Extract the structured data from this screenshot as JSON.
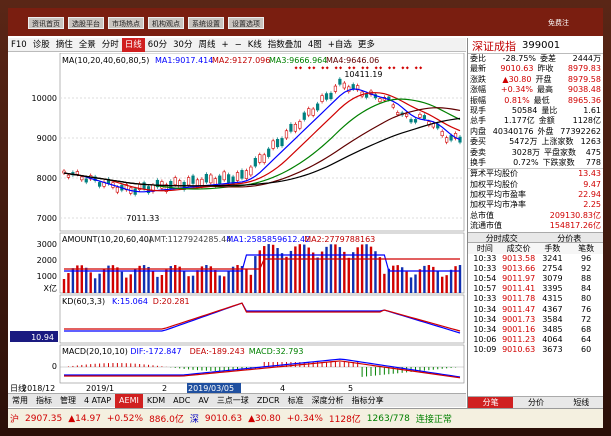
{
  "menubar": {
    "buttons": [
      "资讯首页",
      "选股平台",
      "市场热点",
      "机构观点",
      "系统设置",
      "设置选项"
    ],
    "right_label": "免费注"
  },
  "toolbar": {
    "items": [
      "F10",
      "诊股",
      "摘住",
      "全景",
      "分时",
      "日线",
      "60分",
      "30分",
      "周线",
      "+",
      "−",
      "K线",
      "指数叠加",
      "4图",
      "+自选",
      "更多"
    ],
    "selected": "日线"
  },
  "chart": {
    "price_legend": {
      "name": "MA",
      "params": "(10,20,40,60,80,5)",
      "ma1": "MA1:9017.414",
      "ma2": "MA2:9127.096",
      "ma3": "MA3:9666.964",
      "ma4": "MA4:9646.06"
    },
    "price_axis": [
      "10000",
      "9000",
      "8000",
      "7000"
    ],
    "high_label": "10411.19",
    "low_label": "7011.33",
    "volume_legend": {
      "name": "AMOUNT",
      "params": "(10,20,60,40)",
      "amt": "AMT:1127924285.44",
      "ma1": "MA1:2585859612.42",
      "ma2": "MA2:2779788163"
    },
    "volume_axis": [
      "3000",
      "2000",
      "1000"
    ],
    "volume_unit": "X亿",
    "kd_legend": {
      "name": "KD",
      "params": "(60,3,3)",
      "k": "K:15.064",
      "d": "D:20.281"
    },
    "kd_value": "10.94",
    "macd_legend": {
      "name": "MACD",
      "params": "(20,10,10)",
      "dif": "DIF:-172.847",
      "dea": "DEA:-189.243",
      "macd": "MACD:32.793"
    },
    "macd_axis": [
      "0"
    ],
    "date_labels": [
      "日线",
      "2018/12",
      "2019/1",
      "2",
      "2019/03/05",
      "4",
      "5"
    ]
  },
  "tabs": [
    "常用",
    "指标",
    "管理",
    "4 ATAP",
    "AEMI",
    "KDM",
    "ADC",
    "AV",
    "三点一球",
    "ZDCR",
    "标准",
    "深度分析",
    "指标分享"
  ],
  "tabs_selected": "AEMI",
  "status": {
    "market": "沪",
    "index1": "2907.35",
    "chg1": "▲14.97",
    "pct1": "+0.52%",
    "amt1": "886.0亿",
    "label2": "深",
    "index2": "9010.63",
    "chg2": "▲30.80",
    "pct2": "+0.34%",
    "amt2": "1128亿",
    "count": "1263/778",
    "conn": "连接正常"
  },
  "panel": {
    "name": "深证成指",
    "code": "399001",
    "quote": [
      [
        "委比",
        "-28.75%",
        "委差",
        "2444万"
      ],
      [
        "最新",
        "9010.63",
        "昨收",
        "8979.83"
      ],
      [
        "涨跌",
        "▲30.80",
        "开盘",
        "8979.58"
      ],
      [
        "涨幅",
        "+0.34%",
        "最高",
        "9038.48"
      ],
      [
        "振幅",
        "0.81%",
        "最低",
        "8965.36"
      ],
      [
        "现手",
        "50584",
        "量比",
        "1.61"
      ],
      [
        "总手",
        "1.177亿",
        "金额",
        "1128亿"
      ],
      [
        "内盘",
        "40340176",
        "外盘",
        "77392262"
      ],
      [
        "委买",
        "5472万",
        "上涨家数",
        "1263"
      ],
      [
        "委卖",
        "3028万",
        "平盘家数",
        "475"
      ],
      [
        "换手",
        "0.72%",
        "下跌家数",
        "778"
      ]
    ],
    "stats": [
      [
        "算术平均股价",
        "13.43"
      ],
      [
        "加权平均股价",
        "9.47"
      ],
      [
        "加权平均市盈率",
        "22.94"
      ],
      [
        "加权平均市净率",
        "2.25"
      ],
      [
        "总市值",
        "209130.83亿"
      ],
      [
        "流通市值",
        "154817.26亿"
      ]
    ],
    "trade_tabs": [
      "分时成交",
      "分价表"
    ],
    "trade_headers": [
      "时间",
      "成交价",
      "手数",
      "笔数"
    ],
    "trades": [
      [
        "10:33",
        "9013.58",
        "3241",
        "96"
      ],
      [
        "10:33",
        "9013.66",
        "2754",
        "92"
      ],
      [
        "10:54",
        "9011.97",
        "3079",
        "88"
      ],
      [
        "10:57",
        "9011.41",
        "3395",
        "84"
      ],
      [
        "10:33",
        "9011.78",
        "4315",
        "80"
      ],
      [
        "10:34",
        "9011.47",
        "4367",
        "76"
      ],
      [
        "10:34",
        "9001.73",
        "3584",
        "72"
      ],
      [
        "10:34",
        "9001.16",
        "3485",
        "68"
      ],
      [
        "10:06",
        "9011.23",
        "4064",
        "64"
      ],
      [
        "10:09",
        "9010.63",
        "3673",
        "60"
      ]
    ],
    "bottom_tabs": [
      "分笔",
      "分价",
      "短线"
    ],
    "bottom_selected": "分笔"
  }
}
